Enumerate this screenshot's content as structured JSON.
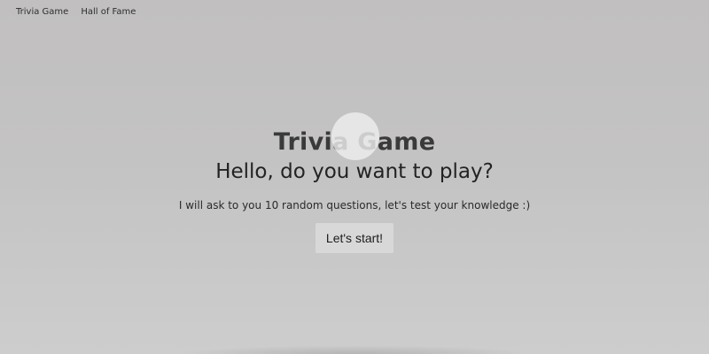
{
  "nav": {
    "items": [
      {
        "label": "Trivia Game"
      },
      {
        "label": "Hall of Fame"
      }
    ]
  },
  "hero": {
    "title": "Trivia Game",
    "greeting": "Hello, do you want to play?",
    "intro": "I will ask to you 10 random questions, let's test your knowledge :)",
    "start_label": "Let's start!"
  }
}
